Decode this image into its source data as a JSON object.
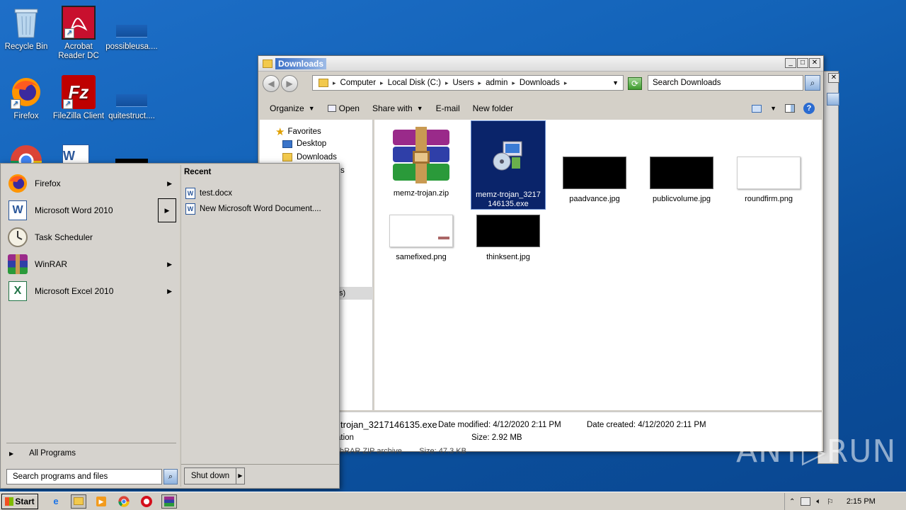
{
  "desktop": {
    "icons": [
      {
        "label": "Recycle Bin"
      },
      {
        "label": "Acrobat Reader DC"
      },
      {
        "label": "possibleusa...."
      },
      {
        "label": "Firefox"
      },
      {
        "label": "FileZilla Client"
      },
      {
        "label": "quitestruct...."
      }
    ]
  },
  "explorer": {
    "title": "Downloads",
    "address": [
      "Computer",
      "Local Disk (C:)",
      "Users",
      "admin",
      "Downloads"
    ],
    "search_placeholder": "Search Downloads",
    "toolbar": {
      "organize": "Organize",
      "open": "Open",
      "share_with": "Share with",
      "email": "E-mail",
      "new_folder": "New folder"
    },
    "nav": {
      "favorites": "Favorites",
      "desktop": "Desktop",
      "downloads": "Downloads",
      "partial_s": "s",
      "partial_paren": "s)"
    },
    "files": [
      {
        "name": "memz-trojan.zip"
      },
      {
        "name": "memz-trojan_3217146135.exe"
      },
      {
        "name": "paadvance.jpg"
      },
      {
        "name": "publicvolume.jpg"
      },
      {
        "name": "roundfirm.png"
      },
      {
        "name": "samefixed.png"
      },
      {
        "name": "thinksent.jpg"
      }
    ],
    "details": {
      "name_partial": "trojan_3217146135.exe",
      "type_partial": "ation",
      "date_modified": "Date modified: 4/12/2020 2:11 PM",
      "date_created": "Date created: 4/12/2020 2:11 PM",
      "size": "Size: 2.92 MB",
      "behind_row": "hRAR ZIP archive        Size: 47.3 KB"
    }
  },
  "start_menu": {
    "programs": [
      {
        "label": "Firefox"
      },
      {
        "label": "Microsoft Word 2010"
      },
      {
        "label": "Task Scheduler"
      },
      {
        "label": "WinRAR"
      },
      {
        "label": "Microsoft Excel 2010"
      }
    ],
    "all_programs": "All Programs",
    "search_placeholder": "Search programs and files",
    "recent_title": "Recent",
    "recent_items": [
      {
        "label": "test.docx"
      },
      {
        "label": "New Microsoft Word Document...."
      }
    ],
    "shutdown": "Shut down"
  },
  "taskbar": {
    "start": "Start",
    "clock": "2:15 PM"
  },
  "watermark": "ANY▷RUN"
}
